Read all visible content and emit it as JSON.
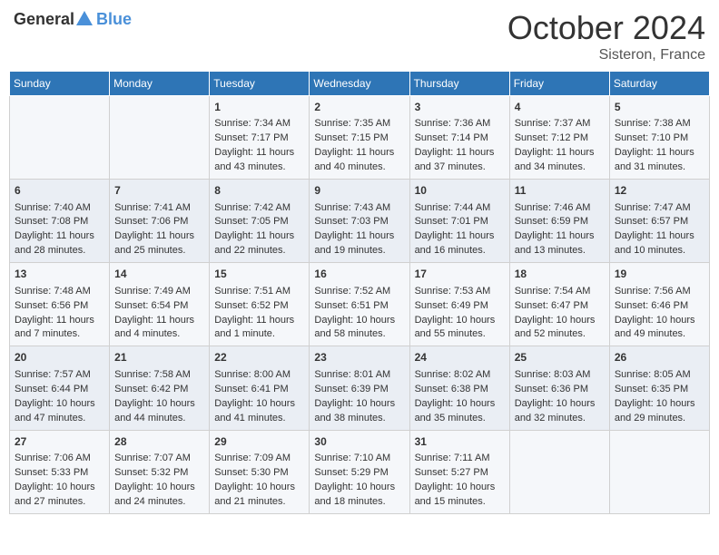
{
  "logo": {
    "general": "General",
    "blue": "Blue"
  },
  "title": "October 2024",
  "subtitle": "Sisteron, France",
  "weekdays": [
    "Sunday",
    "Monday",
    "Tuesday",
    "Wednesday",
    "Thursday",
    "Friday",
    "Saturday"
  ],
  "weeks": [
    [
      {
        "day": "",
        "info": ""
      },
      {
        "day": "",
        "info": ""
      },
      {
        "day": "1",
        "info": "Sunrise: 7:34 AM\nSunset: 7:17 PM\nDaylight: 11 hours and 43 minutes."
      },
      {
        "day": "2",
        "info": "Sunrise: 7:35 AM\nSunset: 7:15 PM\nDaylight: 11 hours and 40 minutes."
      },
      {
        "day": "3",
        "info": "Sunrise: 7:36 AM\nSunset: 7:14 PM\nDaylight: 11 hours and 37 minutes."
      },
      {
        "day": "4",
        "info": "Sunrise: 7:37 AM\nSunset: 7:12 PM\nDaylight: 11 hours and 34 minutes."
      },
      {
        "day": "5",
        "info": "Sunrise: 7:38 AM\nSunset: 7:10 PM\nDaylight: 11 hours and 31 minutes."
      }
    ],
    [
      {
        "day": "6",
        "info": "Sunrise: 7:40 AM\nSunset: 7:08 PM\nDaylight: 11 hours and 28 minutes."
      },
      {
        "day": "7",
        "info": "Sunrise: 7:41 AM\nSunset: 7:06 PM\nDaylight: 11 hours and 25 minutes."
      },
      {
        "day": "8",
        "info": "Sunrise: 7:42 AM\nSunset: 7:05 PM\nDaylight: 11 hours and 22 minutes."
      },
      {
        "day": "9",
        "info": "Sunrise: 7:43 AM\nSunset: 7:03 PM\nDaylight: 11 hours and 19 minutes."
      },
      {
        "day": "10",
        "info": "Sunrise: 7:44 AM\nSunset: 7:01 PM\nDaylight: 11 hours and 16 minutes."
      },
      {
        "day": "11",
        "info": "Sunrise: 7:46 AM\nSunset: 6:59 PM\nDaylight: 11 hours and 13 minutes."
      },
      {
        "day": "12",
        "info": "Sunrise: 7:47 AM\nSunset: 6:57 PM\nDaylight: 11 hours and 10 minutes."
      }
    ],
    [
      {
        "day": "13",
        "info": "Sunrise: 7:48 AM\nSunset: 6:56 PM\nDaylight: 11 hours and 7 minutes."
      },
      {
        "day": "14",
        "info": "Sunrise: 7:49 AM\nSunset: 6:54 PM\nDaylight: 11 hours and 4 minutes."
      },
      {
        "day": "15",
        "info": "Sunrise: 7:51 AM\nSunset: 6:52 PM\nDaylight: 11 hours and 1 minute."
      },
      {
        "day": "16",
        "info": "Sunrise: 7:52 AM\nSunset: 6:51 PM\nDaylight: 10 hours and 58 minutes."
      },
      {
        "day": "17",
        "info": "Sunrise: 7:53 AM\nSunset: 6:49 PM\nDaylight: 10 hours and 55 minutes."
      },
      {
        "day": "18",
        "info": "Sunrise: 7:54 AM\nSunset: 6:47 PM\nDaylight: 10 hours and 52 minutes."
      },
      {
        "day": "19",
        "info": "Sunrise: 7:56 AM\nSunset: 6:46 PM\nDaylight: 10 hours and 49 minutes."
      }
    ],
    [
      {
        "day": "20",
        "info": "Sunrise: 7:57 AM\nSunset: 6:44 PM\nDaylight: 10 hours and 47 minutes."
      },
      {
        "day": "21",
        "info": "Sunrise: 7:58 AM\nSunset: 6:42 PM\nDaylight: 10 hours and 44 minutes."
      },
      {
        "day": "22",
        "info": "Sunrise: 8:00 AM\nSunset: 6:41 PM\nDaylight: 10 hours and 41 minutes."
      },
      {
        "day": "23",
        "info": "Sunrise: 8:01 AM\nSunset: 6:39 PM\nDaylight: 10 hours and 38 minutes."
      },
      {
        "day": "24",
        "info": "Sunrise: 8:02 AM\nSunset: 6:38 PM\nDaylight: 10 hours and 35 minutes."
      },
      {
        "day": "25",
        "info": "Sunrise: 8:03 AM\nSunset: 6:36 PM\nDaylight: 10 hours and 32 minutes."
      },
      {
        "day": "26",
        "info": "Sunrise: 8:05 AM\nSunset: 6:35 PM\nDaylight: 10 hours and 29 minutes."
      }
    ],
    [
      {
        "day": "27",
        "info": "Sunrise: 7:06 AM\nSunset: 5:33 PM\nDaylight: 10 hours and 27 minutes."
      },
      {
        "day": "28",
        "info": "Sunrise: 7:07 AM\nSunset: 5:32 PM\nDaylight: 10 hours and 24 minutes."
      },
      {
        "day": "29",
        "info": "Sunrise: 7:09 AM\nSunset: 5:30 PM\nDaylight: 10 hours and 21 minutes."
      },
      {
        "day": "30",
        "info": "Sunrise: 7:10 AM\nSunset: 5:29 PM\nDaylight: 10 hours and 18 minutes."
      },
      {
        "day": "31",
        "info": "Sunrise: 7:11 AM\nSunset: 5:27 PM\nDaylight: 10 hours and 15 minutes."
      },
      {
        "day": "",
        "info": ""
      },
      {
        "day": "",
        "info": ""
      }
    ]
  ]
}
